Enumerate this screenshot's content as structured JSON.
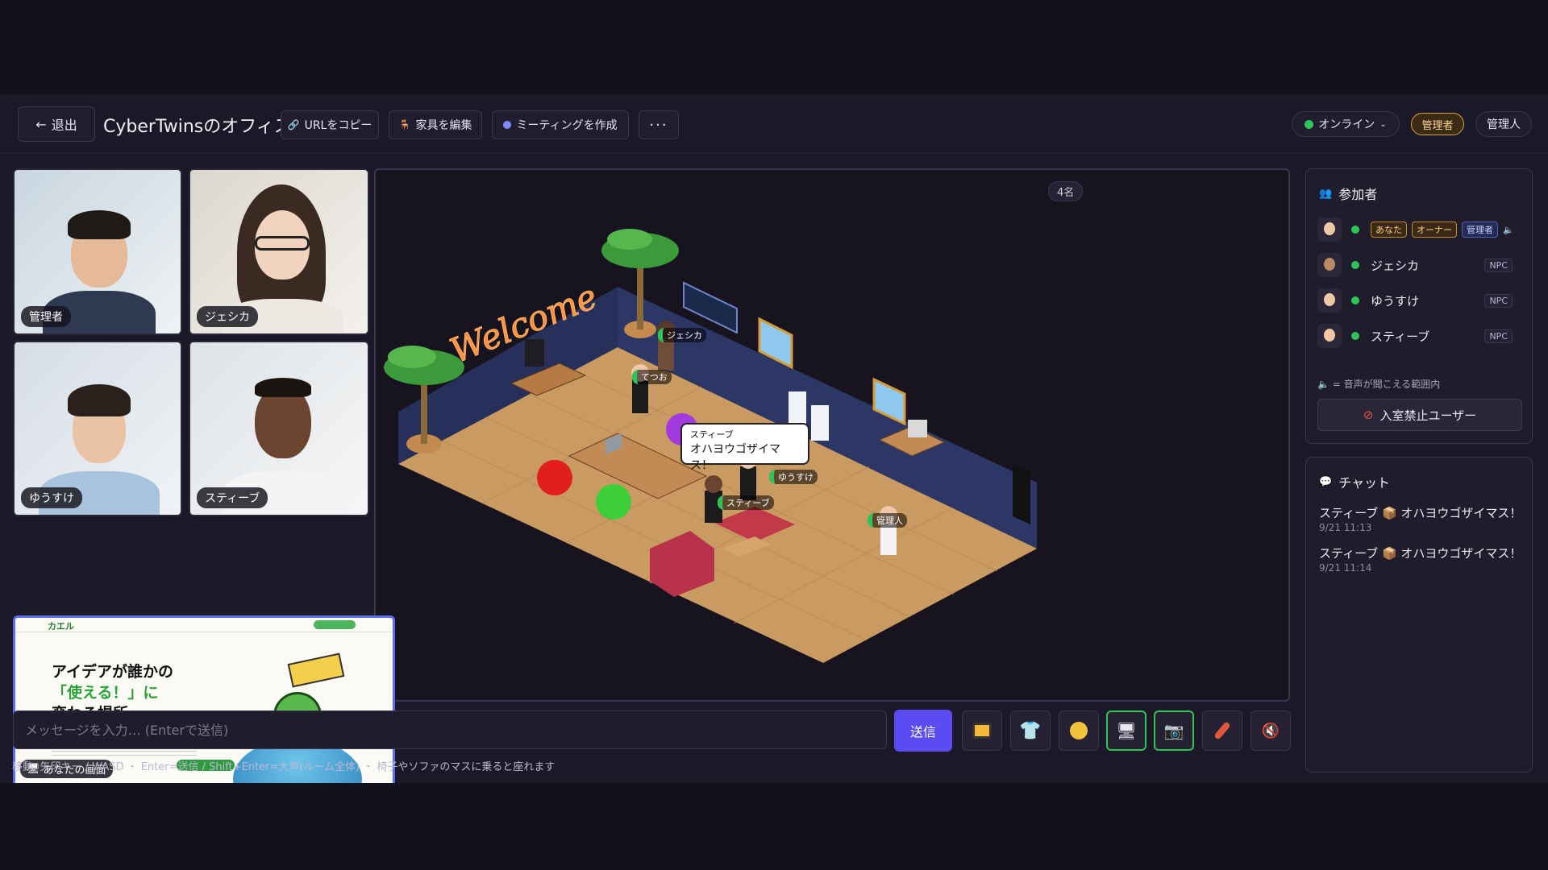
{
  "header": {
    "exit_label": "退出",
    "room_title": "CyberTwinsのオフィス",
    "copy_url": "URLをコピー",
    "edit_furniture": "家具を編集",
    "create_meeting": "ミーティングを作成",
    "more": "···",
    "status": "オンライン",
    "role_badge": "管理者",
    "user_name": "管理人"
  },
  "videos": [
    {
      "label": "管理者"
    },
    {
      "label": "ジェシカ"
    },
    {
      "label": "ゆうすけ"
    },
    {
      "label": "スティーブ"
    }
  ],
  "screen_share": {
    "label": "あなたの画面",
    "logo": "カエル",
    "headline_1": "アイデアが誰かの",
    "headline_2": "「使える！」に",
    "headline_3": "変わる場所。"
  },
  "room": {
    "count": "4名",
    "welcome": "Welcome",
    "speech_name": "スティーブ",
    "speech_text": "オハヨウゴザイマス！",
    "avatars": [
      "ジェシカ",
      "てつお",
      "ゆうすけ",
      "スティーブ",
      "管理人"
    ]
  },
  "composer": {
    "placeholder": "メッセージを入力… (Enterで送信)",
    "send": "送信",
    "hint": "移動: 矢印キー / WASD  ・ Enter=送信 / Shift+Enter=大声(ルーム全体)  ・ 椅子やソファのマスに乗ると座れます"
  },
  "participants": {
    "title": "参加者",
    "you_tags": [
      "あなた",
      "オーナー",
      "管理者"
    ],
    "list": [
      {
        "name": "ジェシカ",
        "tag": "NPC"
      },
      {
        "name": "ゆうすけ",
        "tag": "NPC"
      },
      {
        "name": "スティーブ",
        "tag": "NPC"
      }
    ],
    "legend": "= 音声が聞こえる範囲内",
    "ban_button": "入室禁止ユーザー"
  },
  "chat": {
    "title": "チャット",
    "messages": [
      {
        "text": "スティーブ 📦 オハヨウゴザイマス！",
        "time": "9/21 11:13"
      },
      {
        "text": "スティーブ 📦 オハヨウゴザイマス！",
        "time": "9/21 11:14"
      }
    ]
  },
  "colors": {
    "accent": "#5a4bf2",
    "online": "#2ec458",
    "admin_badge": "#d9a44a"
  }
}
